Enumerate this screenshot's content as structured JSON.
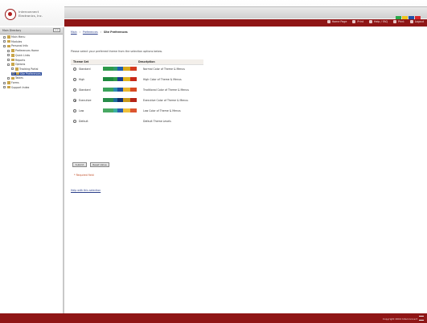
{
  "header": {
    "brand_line1": "Interconnect",
    "brand_line2": "Electronics, Inc.",
    "brand_colors": [
      "#2aa94a",
      "#f0c419",
      "#1d4fa8",
      "#d7262b"
    ],
    "nav": [
      {
        "label": "Home Page",
        "icon": "home-icon"
      },
      {
        "label": "Print",
        "icon": "print-icon"
      },
      {
        "label": "Help / FAQ",
        "icon": "help-icon"
      },
      {
        "label": "Print",
        "icon": "printer-icon"
      },
      {
        "label": "Logout",
        "icon": "logout-icon"
      }
    ]
  },
  "sidebar": {
    "title": "Main Directory",
    "collapse_label": "<<",
    "items": [
      {
        "label": "Main Menu",
        "indent": 0
      },
      {
        "label": "Modules",
        "indent": 0
      },
      {
        "label": "Personal Info",
        "indent": 0
      },
      {
        "label": "Preferences Home",
        "indent": 1
      },
      {
        "label": "Quick Links",
        "indent": 1
      },
      {
        "label": "Reports",
        "indent": 1
      },
      {
        "label": "Options",
        "indent": 1
      },
      {
        "label": "Tracking Portal",
        "indent": 2
      },
      {
        "label": "Site Preferences",
        "indent": 2,
        "selected": true
      },
      {
        "label": "Tables",
        "indent": 1
      },
      {
        "label": "Forms",
        "indent": 0
      },
      {
        "label": "Support Index",
        "indent": 0
      }
    ]
  },
  "breadcrumb": {
    "home": "Main",
    "section": "Preferences",
    "current": "Site Preferences"
  },
  "instructions": "Please select your preferred theme from the selection options below.",
  "table": {
    "col_theme": "Theme Set",
    "col_desc": "Description",
    "rows": [
      {
        "name": "Standard",
        "desc": "Normal Color of Theme & Menus",
        "selected": false,
        "colors": [
          "#2e9a4a",
          "#2f9a6b",
          "#1f5fae",
          "#d9aa1a",
          "#d43a1f"
        ]
      },
      {
        "name": "High",
        "desc": "High Color of Theme & Menus",
        "selected": false,
        "colors": [
          "#1e8a3e",
          "#2e9a4a",
          "#193f8e",
          "#e0b41d",
          "#c72a1a"
        ]
      },
      {
        "name": "Standard",
        "desc": "Traditional Color of Theme & Menus",
        "selected": false,
        "colors": [
          "#3aa35a",
          "#2a8ab2",
          "#1f4f9e",
          "#e8b62d",
          "#d84a24"
        ]
      },
      {
        "name": "Executive",
        "desc": "Executive Color of Theme & Menus",
        "selected": true,
        "colors": [
          "#278c49",
          "#1b6a9a",
          "#0f2e6e",
          "#c8981a",
          "#b52417"
        ]
      },
      {
        "name": "Low",
        "desc": "Low Color of Theme & Menus",
        "selected": false,
        "colors": [
          "#48a862",
          "#3ab0a0",
          "#2a5fb0",
          "#efc03a",
          "#dc5530"
        ]
      },
      {
        "name": "Default",
        "desc": "Default Theme Levels",
        "selected": false,
        "colors": []
      }
    ]
  },
  "buttons": {
    "save": "Submit",
    "cancel": "Reset Value"
  },
  "note": "* Required field",
  "help_link": "Help with this selection",
  "footer": {
    "copyright": "Copyright 2004 Interconnect"
  }
}
